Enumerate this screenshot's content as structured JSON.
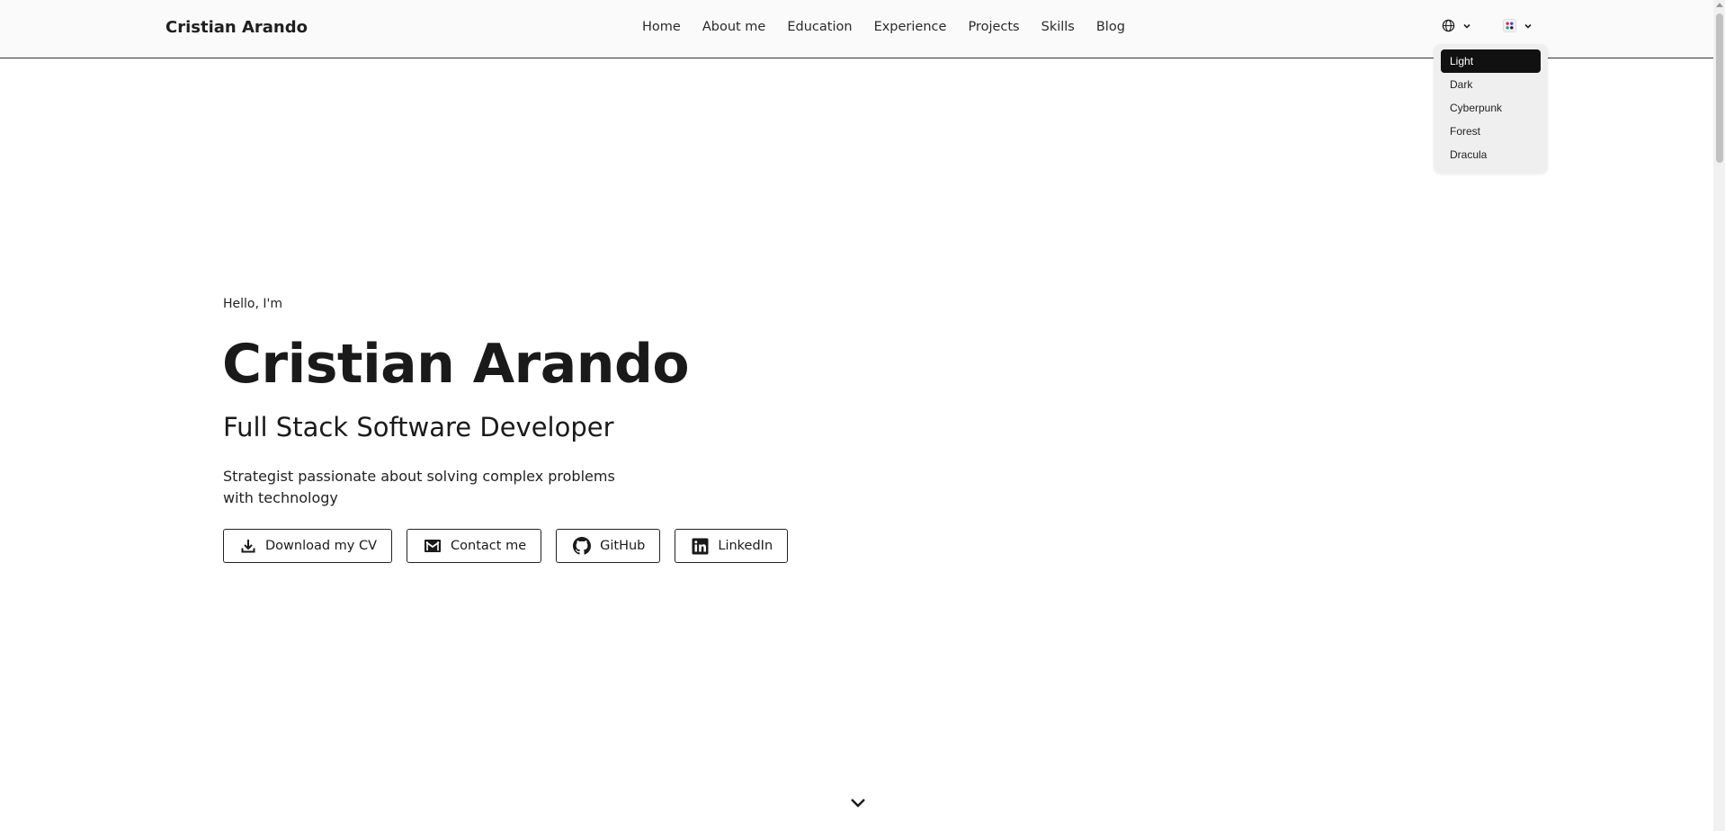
{
  "header": {
    "brand": "Cristian Arando",
    "nav": [
      "Home",
      "About me",
      "Education",
      "Experience",
      "Projects",
      "Skills",
      "Blog"
    ],
    "language_icon": "globe-icon",
    "theme_icon": "palette-icon"
  },
  "theme_menu": {
    "items": [
      "Light",
      "Dark",
      "Cyberpunk",
      "Forest",
      "Dracula"
    ],
    "selected": "Light"
  },
  "hero": {
    "greeting": "Hello, I'm",
    "name": "Cristian Arando",
    "role": "Full Stack Software Developer",
    "description": "Strategist passionate about solving complex problems with technology",
    "buttons": [
      {
        "label": "Download my CV",
        "icon": "download-icon"
      },
      {
        "label": "Contact me",
        "icon": "mail-icon"
      },
      {
        "label": "GitHub",
        "icon": "github-icon"
      },
      {
        "label": "LinkedIn",
        "icon": "linkedin-icon"
      }
    ],
    "scroll_icon": "chevron-down-icon"
  },
  "colors": {
    "background": "#ffffff",
    "navbar": "#fafafa",
    "text": "#1a1a1a",
    "menu_bg": "#efefef",
    "menu_active": "#111111"
  }
}
